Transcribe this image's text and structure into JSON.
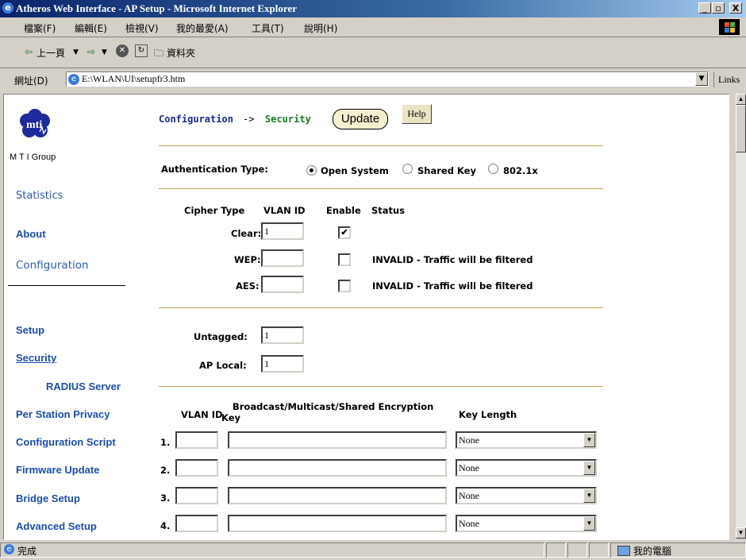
{
  "window": {
    "title": "Atheros Web Interface - AP Setup - Microsoft Internet Explorer",
    "controls": [
      "_",
      "▫",
      "X"
    ]
  },
  "menu": [
    "檔案(F)",
    "編輯(E)",
    "檢視(V)",
    "我的最愛(A)",
    "工具(T)",
    "說明(H)"
  ],
  "toolbar": {
    "back": "上一頁",
    "folders": "資料夾"
  },
  "address": {
    "label": "網址(D)",
    "value": "E:\\WLAN\\UI\\setupfr3.htm",
    "links": "Links"
  },
  "sidebar": {
    "brand": "M T I Group",
    "top_links": [
      "Statistics",
      "About",
      "Configuration"
    ],
    "links": [
      "Setup",
      "Security",
      "RADIUS Server",
      "Per Station Privacy",
      "Configuration Script",
      "Firmware Update",
      "Bridge Setup",
      "Advanced Setup"
    ]
  },
  "header": {
    "crumb_config": "Configuration",
    "arrow": "->",
    "crumb_security": "Security",
    "update_label": "Update",
    "help_label": "Help"
  },
  "auth": {
    "label": "Authentication Type:",
    "options": [
      "Open System",
      "Shared Key",
      "802.1x"
    ],
    "selected": "Open System"
  },
  "cipher": {
    "headers": {
      "type": "Cipher Type",
      "vlan": "VLAN ID",
      "enable": "Enable",
      "status": "Status"
    },
    "rows": [
      {
        "label": "Clear:",
        "vlan": "1",
        "enabled": "✔",
        "status": ""
      },
      {
        "label": "WEP:",
        "vlan": "",
        "enabled": "",
        "status": "INVALID - Traffic will be filtered"
      },
      {
        "label": "AES:",
        "vlan": "",
        "enabled": "",
        "status": "INVALID - Traffic will be filtered"
      }
    ]
  },
  "vlan": {
    "untagged_label": "Untagged:",
    "untagged_value": "1",
    "aplocal_label": "AP Local:",
    "aplocal_value": "1"
  },
  "keys": {
    "headers": {
      "vlan": "VLAN ID",
      "key_line1": "Broadcast/Multicast/Shared Encryption",
      "key_line2": "Key",
      "length": "Key Length"
    },
    "rows": [
      {
        "num": "1.",
        "vlan": "",
        "key": "",
        "length": "None"
      },
      {
        "num": "2.",
        "vlan": "",
        "key": "",
        "length": "None"
      },
      {
        "num": "3.",
        "vlan": "",
        "key": "",
        "length": "None"
      },
      {
        "num": "4.",
        "vlan": "",
        "key": "",
        "length": "None"
      }
    ]
  },
  "status": {
    "left": "完成",
    "zone": "我的電腦"
  },
  "colors": {
    "link": "#1a4db3",
    "crumb": "#1a2a9a",
    "crumb_active": "#1e7a2a",
    "rule": "#c8a450"
  }
}
